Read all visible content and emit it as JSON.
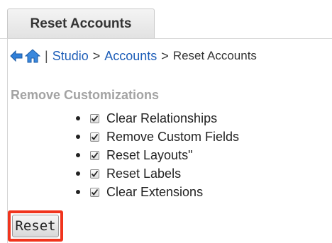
{
  "tab": {
    "label": "Reset Accounts"
  },
  "breadcrumb": {
    "back_icon": "back-arrow-icon",
    "home_icon": "home-icon",
    "separator": "|",
    "items": [
      "Studio",
      "Accounts",
      "Reset Accounts"
    ],
    "arrow": ">"
  },
  "section": {
    "title": "Remove Customizations",
    "options": [
      {
        "label": "Clear Relationships",
        "checked": true
      },
      {
        "label": "Remove Custom Fields",
        "checked": true
      },
      {
        "label": "Reset Layouts\"",
        "checked": true
      },
      {
        "label": "Reset Labels",
        "checked": true
      },
      {
        "label": "Clear Extensions",
        "checked": true
      }
    ]
  },
  "reset_button": {
    "label": "Reset"
  },
  "colors": {
    "link": "#1e5eb8",
    "highlight": "#f0341d",
    "muted_title": "#a3a3a3"
  }
}
